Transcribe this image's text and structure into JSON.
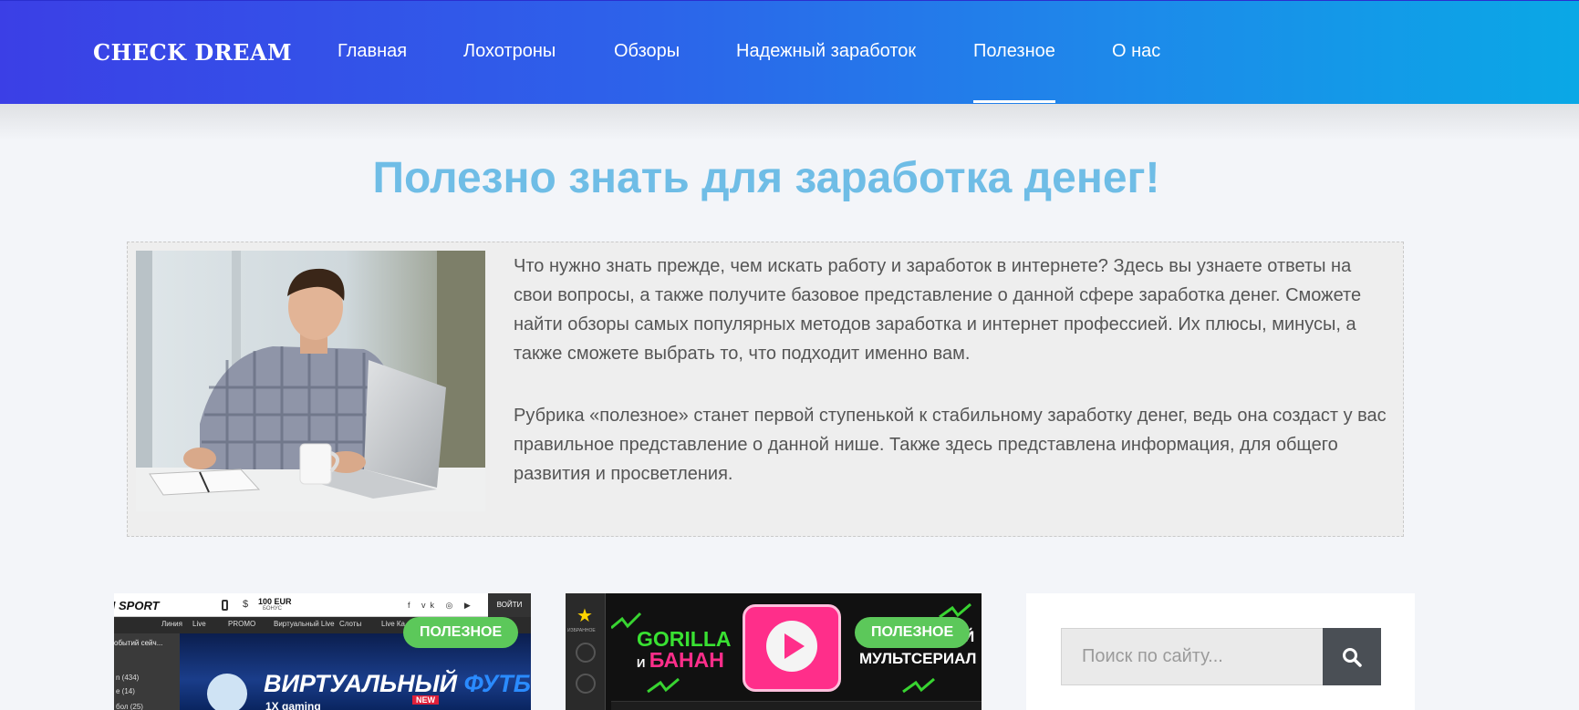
{
  "header": {
    "logo": "CHECK DREAM",
    "nav": [
      {
        "label": "Главная"
      },
      {
        "label": "Лохотроны"
      },
      {
        "label": "Обзоры"
      },
      {
        "label": "Надежный заработок"
      },
      {
        "label": "Полезное",
        "active": true
      },
      {
        "label": "О нас"
      }
    ]
  },
  "main": {
    "title": "Полезно знать для заработка денег!",
    "intro": {
      "paragraph1": "Что нужно знать прежде, чем искать работу и заработок в интернете? Здесь вы узнаете ответы на свои вопросы, а также получите базовое представление о данной сфере заработка денег. Сможете найти обзоры самых  популярных методов заработка и интернет профессией. Их плюсы, минусы, а также сможете выбрать то, что подходит именно вам.",
      "paragraph2": "Рубрика «полезное» станет первой ступенькой к стабильному заработку денег, ведь она создаст у вас правильное представление о данной нише. Также здесь представлена информация, для общего развития и просветления."
    },
    "cards": [
      {
        "badge": "ПОЛЕЗНОЕ",
        "thumb": {
          "brand": "N SPORT",
          "bonus_amount": "100 EUR",
          "bonus_label": "БОНУС",
          "login": "ВОЙТИ",
          "menu": [
            "Линия",
            "Live",
            "PROMO",
            "Виртуальный Live",
            "Слоты",
            "Live Ка"
          ],
          "side_title": "обытий сейч...",
          "side_items": [
            "n (434)",
            "e (14)",
            "бол (25)"
          ],
          "banner_word1": "ВИРТУАЛЬНЫЙ",
          "banner_word2": "ФУТБО",
          "provider": "1Х gaming",
          "new": "NEW"
        }
      },
      {
        "badge": "ПОЛЕЗНОЕ",
        "thumb": {
          "side_label": "ИЗБРАННОЕ",
          "line1": "GORILLA",
          "line2_small": "И",
          "line2": "БАНАН",
          "right_partial": "Й",
          "right_word": "МУЛЬТСЕРИАЛ"
        }
      }
    ]
  },
  "sidebar": {
    "search": {
      "placeholder": "Поиск по сайту..."
    }
  },
  "colors": {
    "header_gradient_start": "#3b3fe6",
    "header_gradient_end": "#0aa8e6",
    "title": "#6fbde6",
    "badge": "#5cc85a",
    "search_button": "#4a4f55"
  }
}
